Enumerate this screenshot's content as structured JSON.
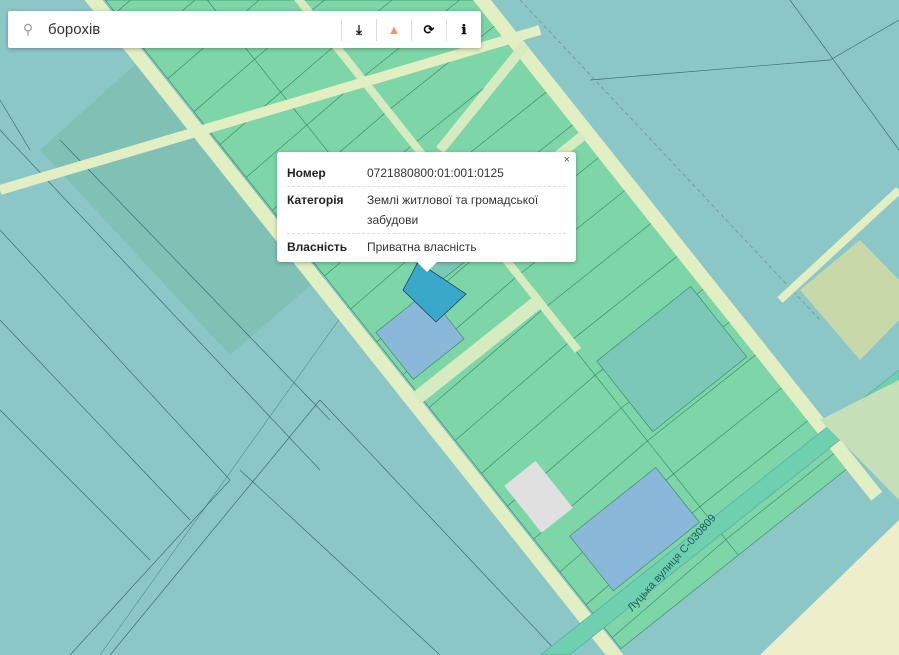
{
  "search": {
    "value": "борохів",
    "icon": "search-icon"
  },
  "toolbar": [
    {
      "icon": "download-icon",
      "glyph": "⤓"
    },
    {
      "icon": "warning-icon",
      "glyph": "▲"
    },
    {
      "icon": "refresh-icon",
      "glyph": "⟳"
    },
    {
      "icon": "info-icon",
      "glyph": "ℹ"
    }
  ],
  "popup": {
    "close": "×",
    "rows": [
      {
        "label": "Номер",
        "value": "0721880800:01:001:0125"
      },
      {
        "label": "Категорія",
        "value": "Землі житлової та громадської забудови"
      },
      {
        "label": "Власність",
        "value": "Приватна власність"
      }
    ]
  },
  "map": {
    "street_label": "Луцька вулиця  С-030809",
    "colors": {
      "parcel_green": "#7dd6a8",
      "parcel_teal": "#8cc7c8",
      "parcel_blue": "#8ab8d8",
      "selected": "#3aa8c8",
      "road": "#e2efc2"
    }
  }
}
